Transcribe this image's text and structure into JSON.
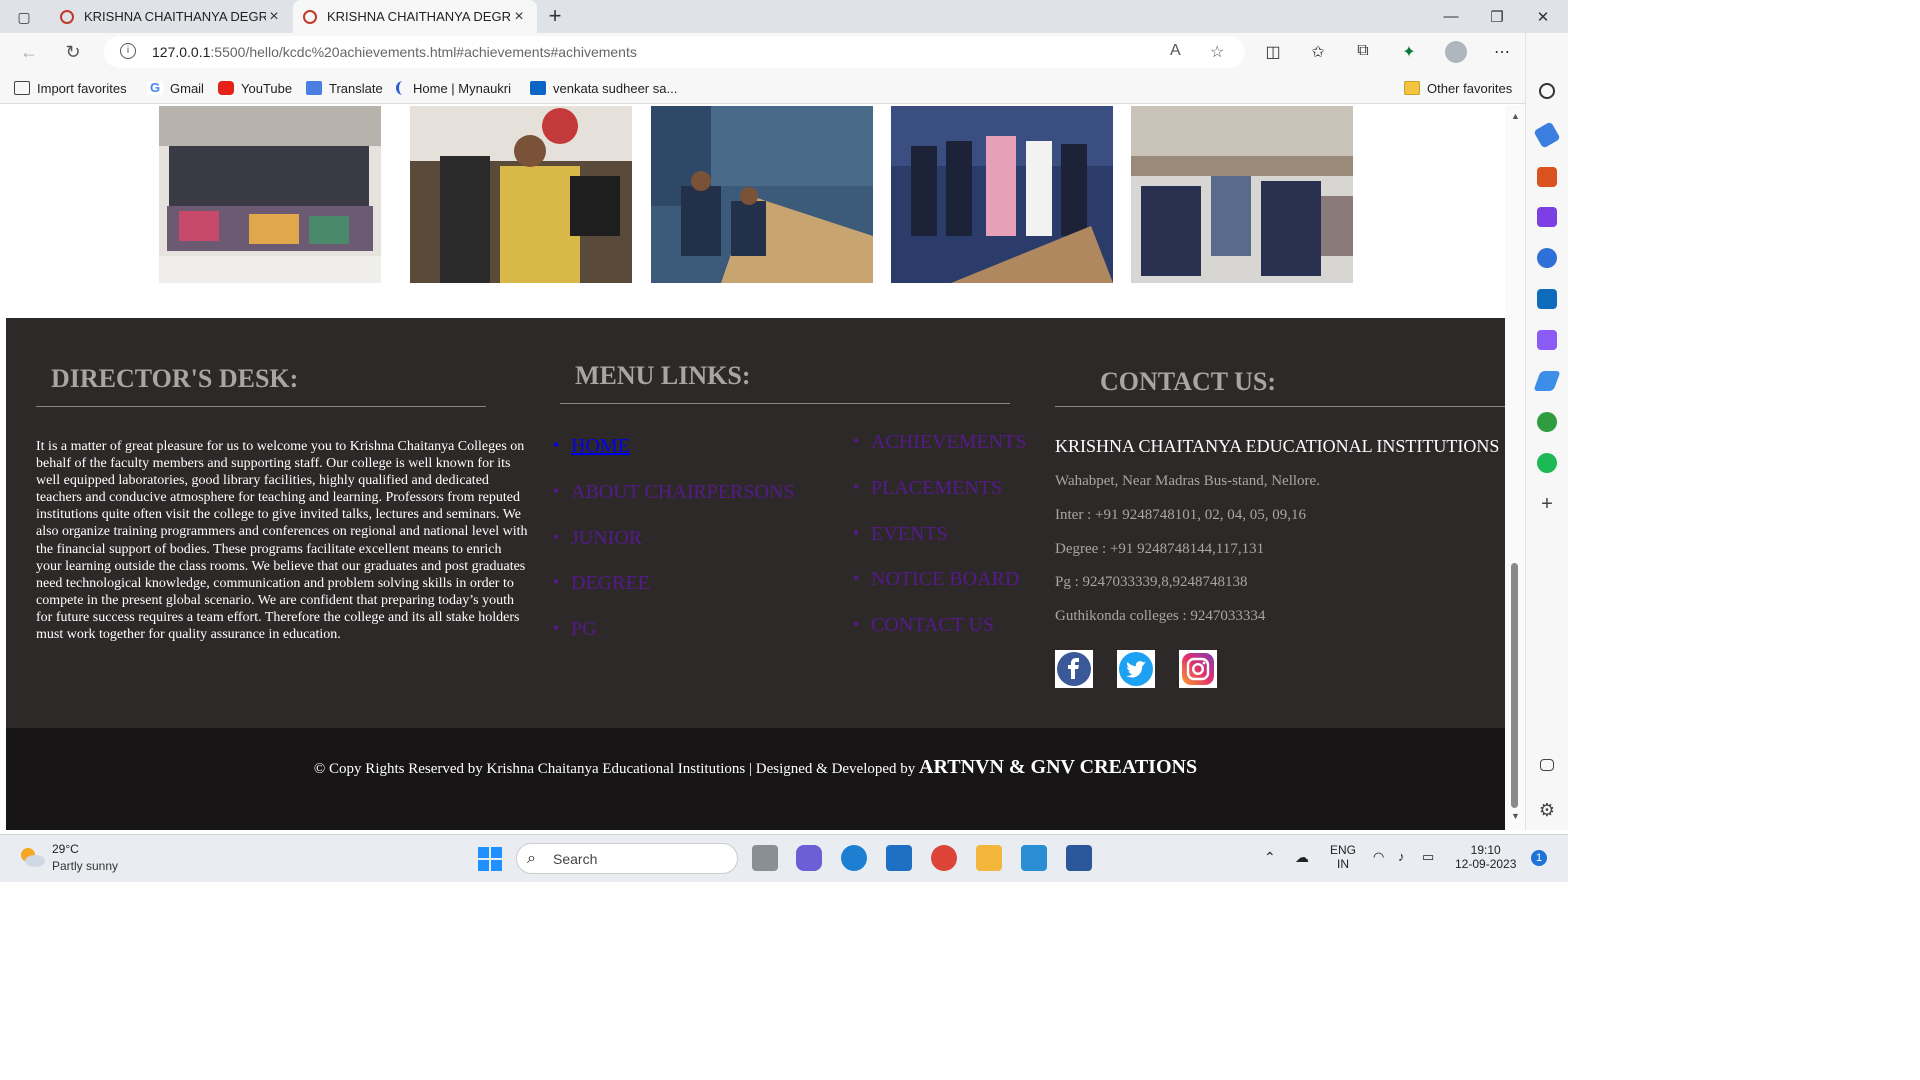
{
  "browser": {
    "tabs": [
      {
        "title": "KRISHNA CHAITHANYA DEGREE",
        "active": false
      },
      {
        "title": "KRISHNA CHAITHANYA DEGREE",
        "active": true
      }
    ],
    "url_main": "127.0.0.1",
    "url_rest": ":5500/hello/kcdc%20achievements.html#achievements#achivements",
    "favorites": [
      {
        "label": "Import favorites",
        "icon": "import-icon"
      },
      {
        "label": "Gmail",
        "icon": "google-icon"
      },
      {
        "label": "YouTube",
        "icon": "youtube-icon"
      },
      {
        "label": "Translate",
        "icon": "translate-icon"
      },
      {
        "label": "Home | Mynaukri",
        "icon": "mynaukri-icon"
      },
      {
        "label": "venkata sudheer sa...",
        "icon": "linkedin-icon"
      }
    ],
    "other_favorites": "Other favorites"
  },
  "footer": {
    "director": {
      "title": "DIRECTOR'S DESK:",
      "text": "It is a matter of great pleasure for us to welcome you to Krishna Chaitanya Colleges on behalf of the faculty members and supporting staff. Our college is well known for its well equipped laboratories, good library facilities, highly qualified and dedicated teachers and conducive atmosphere for teaching and learning. Professors from reputed institutions quite often visit the college to give invited talks, lectures and seminars. We also organize training programmers and conferences on regional and national level with the financial support of bodies. These programs facilitate excellent means to enrich your learning outside the class rooms. We believe that our graduates and post graduates need technological knowledge, communication and problem solving skills in order to compete in the present global scenario. We are confident that preparing today’s youth for future success requires a team effort. Therefore the college and its all stake holders must work together for quality assurance in education."
    },
    "menu": {
      "title": "MENU LINKS:",
      "left": [
        "HOME",
        "ABOUT CHAIRPERSONS",
        "JUNIOR",
        "DEGREE",
        "PG"
      ],
      "right": [
        "ACHIEVEMENTS",
        "PLACEMENTS",
        "EVENTS",
        "NOTICE BOARD",
        "CONTACT US"
      ]
    },
    "contact": {
      "title": "CONTACT US:",
      "org": "KRISHNA CHAITANYA EDUCATIONAL INSTITUTIONS",
      "lines": [
        "Wahabpet, Near Madras Bus-stand, Nellore.",
        "Inter : +91 9248748101, 02, 04, 05, 09,16",
        "Degree : +91 9248748144,117,131",
        "Pg : 9247033339,8,9248748138",
        "Guthikonda colleges : 9247033334"
      ],
      "social": [
        "facebook-icon",
        "twitter-icon",
        "instagram-icon"
      ]
    },
    "copyright": "© Copy Rights Reserved by Krishna Chaitanya Educational Institutions | Designed & Developed by",
    "brand": "ARTNVN & GNV CREATIONS"
  },
  "taskbar": {
    "temp": "29°C",
    "weather": "Partly sunny",
    "search_placeholder": "Search",
    "lang1": "ENG",
    "lang2": "IN",
    "time": "19:10",
    "date": "12-09-2023",
    "notifications": "1"
  }
}
